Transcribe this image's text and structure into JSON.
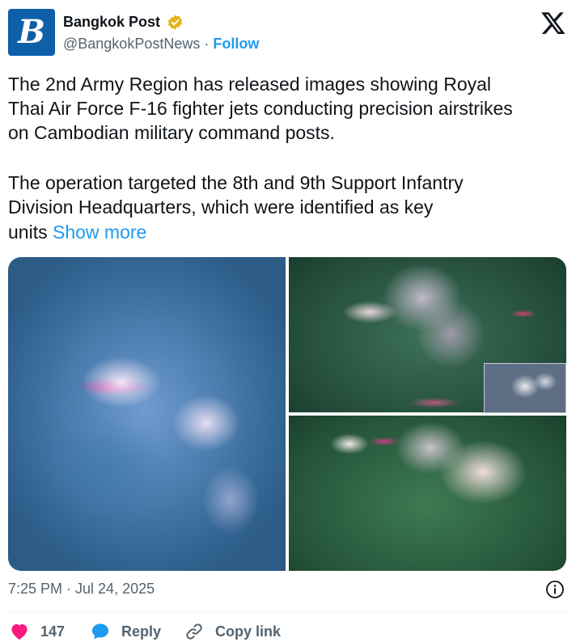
{
  "account": {
    "name": "Bangkok Post",
    "handle": "@BangkokPostNews",
    "separator": "·",
    "follow_label": "Follow",
    "logo_letter": "B",
    "brand_color": "#0d5fa8",
    "verified_color": "#e2b719"
  },
  "tweet": {
    "paragraph1": [
      "The 2nd Army Region has released images showing Royal",
      "Thai Air Force F-16 fighter jets conducting precision airstrikes",
      "on Cambodian military command posts."
    ],
    "paragraph2": [
      "The operation targeted the 8th and 9th Support Infantry",
      "Division Headquarters, which were identified as key"
    ],
    "last_line_prefix": "units",
    "show_more_label": "Show more",
    "link_color": "#1d9bf0"
  },
  "footer": {
    "timestamp": "7:25 PM · Jul 24, 2025",
    "likes_count": "147",
    "reply_label": "Reply",
    "copy_link_label": "Copy link",
    "like_color": "#f91880",
    "reply_color": "#1d9bf0"
  },
  "icons": [
    "verified-badge-icon",
    "x-logo-icon",
    "info-icon",
    "heart-icon",
    "reply-bubble-icon",
    "link-icon"
  ]
}
